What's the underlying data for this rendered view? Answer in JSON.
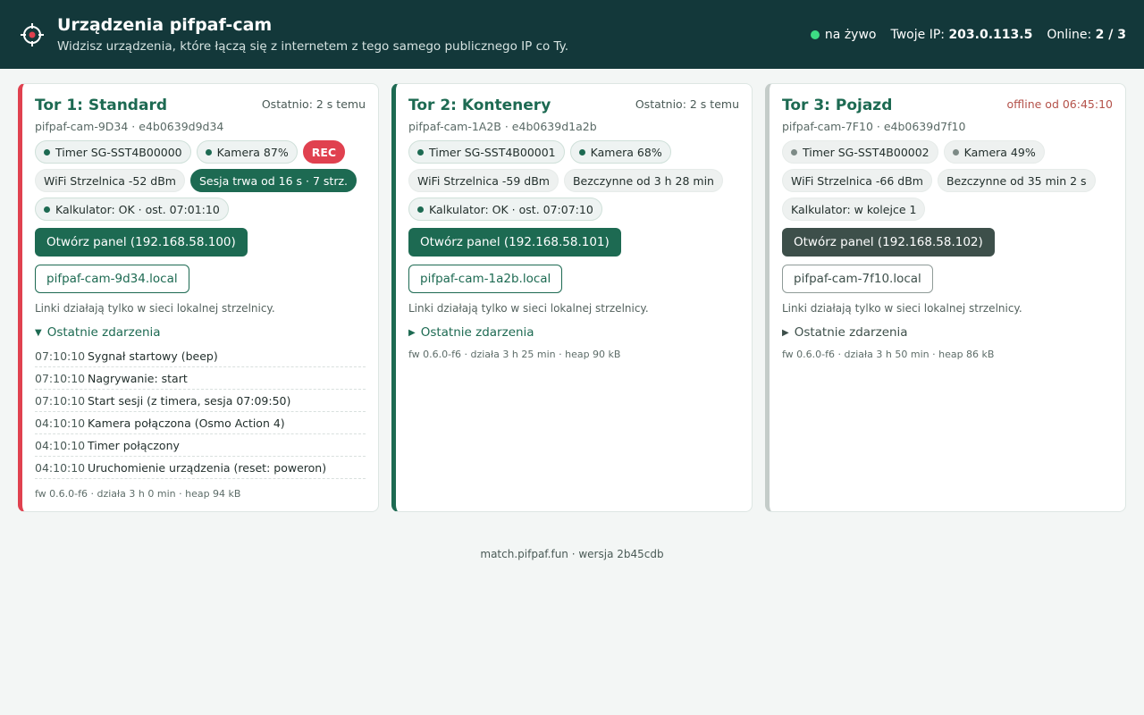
{
  "header": {
    "title": "Urządzenia pifpaf-cam",
    "subtitle": "Widzisz urządzenia, które łączą się z internetem z tego samego publicznego IP co Ty.",
    "live_label": "na żywo",
    "ip_label": "Twoje IP:",
    "ip_value": "203.0.113.5",
    "online_label": "Online:",
    "online_value": "2 / 3",
    "live_color": "#3ddc84"
  },
  "cards": [
    {
      "title": "Tor 1: Standard",
      "last": "Ostatnio: 2 s temu",
      "id": "pifpaf-cam-9D34 · e4b0639d9d34",
      "timer": "Timer SG-SST4B00000",
      "camera": "Kamera 87%",
      "rec": "REC",
      "wifi": "WiFi Strzelnica -52 dBm",
      "session": "Sesja trwa od 16 s · 7 strz.",
      "calc": "Kalkulator: OK · ost. 07:01:10",
      "panel_btn": "Otwórz panel (192.168.58.100)",
      "local_link": "pifpaf-cam-9d34.local",
      "note": "Linki działają tylko w sieci lokalnej strzelnicy.",
      "events_label": "Ostatnie zdarzenia",
      "events": [
        {
          "time": "07:10:10",
          "msg": "Sygnał startowy (beep)"
        },
        {
          "time": "07:10:10",
          "msg": "Nagrywanie: start"
        },
        {
          "time": "07:10:10",
          "msg": "Start sesji (z timera, sesja 07:09:50)"
        },
        {
          "time": "04:10:10",
          "msg": "Kamera połączona (Osmo Action 4)"
        },
        {
          "time": "04:10:10",
          "msg": "Timer połączony"
        },
        {
          "time": "04:10:10",
          "msg": "Uruchomienie urządzenia (reset: poweron)"
        }
      ],
      "fw": "fw 0.6.0-f6 · działa 3 h 0 min · heap 94 kB"
    },
    {
      "title": "Tor 2: Kontenery",
      "last": "Ostatnio: 2 s temu",
      "id": "pifpaf-cam-1A2B · e4b0639d1a2b",
      "timer": "Timer SG-SST4B00001",
      "camera": "Kamera 68%",
      "wifi": "WiFi Strzelnica -59 dBm",
      "idle": "Bezczynne od 3 h 28 min",
      "calc": "Kalkulator: OK · ost. 07:07:10",
      "panel_btn": "Otwórz panel (192.168.58.101)",
      "local_link": "pifpaf-cam-1a2b.local",
      "note": "Linki działają tylko w sieci lokalnej strzelnicy.",
      "events_label": "Ostatnie zdarzenia",
      "fw": "fw 0.6.0-f6 · działa 3 h 25 min · heap 90 kB"
    },
    {
      "title": "Tor 3: Pojazd",
      "last": "offline od 06:45:10",
      "id": "pifpaf-cam-7F10 · e4b0639d7f10",
      "timer": "Timer SG-SST4B00002",
      "camera": "Kamera 49%",
      "wifi": "WiFi Strzelnica -66 dBm",
      "idle": "Bezczynne od 35 min 2 s",
      "calc": "Kalkulator: w kolejce 1",
      "panel_btn": "Otwórz panel (192.168.58.102)",
      "local_link": "pifpaf-cam-7f10.local",
      "note": "Linki działają tylko w sieci lokalnej strzelnicy.",
      "events_label": "Ostatnie zdarzenia",
      "fw": "fw 0.6.0-f6 · działa 3 h 50 min · heap 86 kB"
    }
  ],
  "footer": "match.pifpaf.fun · wersja 2b45cdb"
}
